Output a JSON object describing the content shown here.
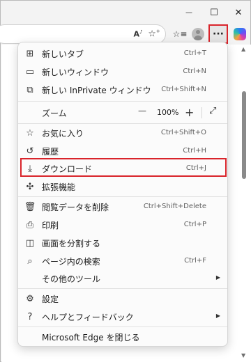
{
  "window": {
    "minimize_glyph": "—",
    "maximize_glyph": "☐",
    "close_glyph": "✕"
  },
  "toolbar": {
    "read_aloud_icon": "read-aloud-icon",
    "add_favorite_icon": "add-favorite-icon",
    "favorites_icon": "favorites-icon",
    "profile_icon": "profile-icon",
    "more_label": "···",
    "copilot_icon": "copilot-icon"
  },
  "menu": {
    "items": [
      {
        "label": "新しいタブ",
        "shortcut": "Ctrl+T",
        "icon": "new-tab-icon"
      },
      {
        "label": "新しいウィンドウ",
        "shortcut": "Ctrl+N",
        "icon": "new-window-icon"
      },
      {
        "label": "新しい InPrivate ウィンドウ",
        "shortcut": "Ctrl+Shift+N",
        "icon": "inprivate-icon"
      },
      {
        "label": "お気に入り",
        "shortcut": "Ctrl+Shift+O",
        "icon": "favorites-list-icon"
      },
      {
        "label": "履歴",
        "shortcut": "Ctrl+H",
        "icon": "history-icon"
      },
      {
        "label": "ダウンロード",
        "shortcut": "Ctrl+J",
        "icon": "download-icon"
      },
      {
        "label": "拡張機能",
        "shortcut": "",
        "icon": "extensions-icon"
      },
      {
        "label": "閲覧データを削除",
        "shortcut": "Ctrl+Shift+Delete",
        "icon": "delete-data-icon"
      },
      {
        "label": "印刷",
        "shortcut": "Ctrl+P",
        "icon": "print-icon"
      },
      {
        "label": "画面を分割する",
        "shortcut": "",
        "icon": "split-screen-icon"
      },
      {
        "label": "ページ内の検索",
        "shortcut": "Ctrl+F",
        "icon": "find-icon"
      },
      {
        "label": "その他のツール",
        "shortcut": "",
        "icon": ""
      },
      {
        "label": "設定",
        "shortcut": "",
        "icon": "settings-icon"
      },
      {
        "label": "ヘルプとフィードバック",
        "shortcut": "",
        "icon": "help-icon"
      },
      {
        "label": "Microsoft Edge を閉じる",
        "shortcut": "",
        "icon": ""
      }
    ],
    "zoom": {
      "label": "ズーム",
      "minus": "—",
      "value": "100%",
      "plus": "+",
      "fullscreen_icon": "fullscreen-icon"
    },
    "highlight_color": "#d9242b"
  }
}
